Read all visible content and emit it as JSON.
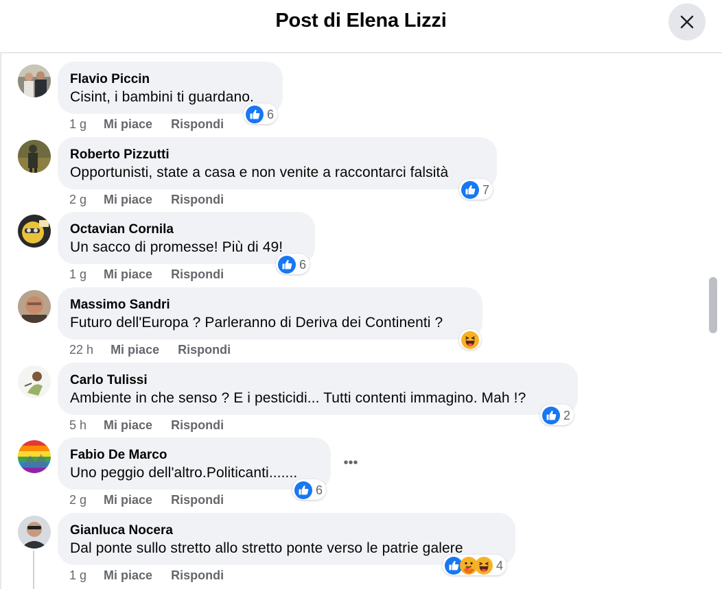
{
  "header": {
    "title": "Post di Elena Lizzi",
    "close_icon": "close-icon"
  },
  "actions": {
    "like": "Mi piace",
    "reply": "Rispondi"
  },
  "colors": {
    "bubble": "#f0f2f5",
    "like_blue": "#1877f2",
    "haha_yellow": "#f7b125",
    "secondary_text": "#65676b"
  },
  "comments": [
    {
      "author": "Flavio Piccin",
      "text": "Cisint, i bambini ti guardano.",
      "time": "1 g",
      "reactions": [
        "like-icon"
      ],
      "count": "6"
    },
    {
      "author": "Roberto Pizzutti",
      "text": "Opportunisti, state a casa e non venite a raccontarci falsità",
      "time": "2 g",
      "reactions": [
        "like-icon"
      ],
      "count": "7"
    },
    {
      "author": "Octavian Cornila",
      "text": "Un sacco di promesse! Più di 49!",
      "time": "1 g",
      "reactions": [
        "like-icon"
      ],
      "count": "6"
    },
    {
      "author": "Massimo Sandri",
      "text": "Futuro dell'Europa ? Parleranno di Deriva dei Continenti ?",
      "time": "22 h",
      "reactions": [
        "haha-icon"
      ],
      "count": ""
    },
    {
      "author": "Carlo Tulissi",
      "text": "Ambiente in che senso ? E i pesticidi... Tutti contenti immagino. Mah !?",
      "time": "5 h",
      "reactions": [
        "like-icon"
      ],
      "count": "2"
    },
    {
      "author": "Fabio De Marco",
      "text": "Uno peggio dell'altro.Politicanti.......",
      "time": "2 g",
      "reactions": [
        "like-icon"
      ],
      "count": "6",
      "more_label": "•••"
    },
    {
      "author": "Gianluca Nocera",
      "text": "Dal ponte sullo stretto allo stretto ponte verso le patrie galere",
      "time": "1 g",
      "reactions": [
        "like-icon",
        "care-icon",
        "haha-icon"
      ],
      "count": "4"
    }
  ]
}
